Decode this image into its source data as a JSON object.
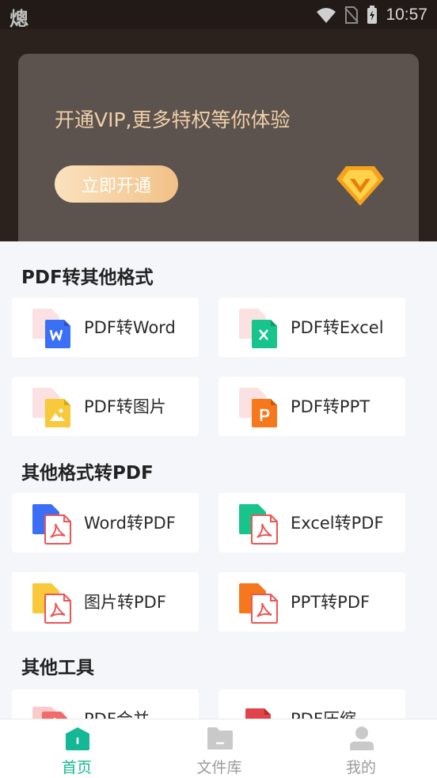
{
  "status_bar": {
    "app_icon": "熜",
    "time": "10:57",
    "icons": [
      "wifi-icon",
      "no-sim-icon",
      "battery-icon"
    ]
  },
  "vip_banner": {
    "text": "开通VIP,更多特权等你体验",
    "button_label": "立即开通",
    "badge_icon": "vip-diamond-icon"
  },
  "sections": [
    {
      "title": "PDF转其他格式",
      "items": [
        {
          "label": "PDF转Word",
          "icon": "pdf-to-word-icon"
        },
        {
          "label": "PDF转Excel",
          "icon": "pdf-to-excel-icon"
        },
        {
          "label": "PDF转图片",
          "icon": "pdf-to-image-icon"
        },
        {
          "label": "PDF转PPT",
          "icon": "pdf-to-ppt-icon"
        }
      ]
    },
    {
      "title": "其他格式转PDF",
      "items": [
        {
          "label": "Word转PDF",
          "icon": "word-to-pdf-icon"
        },
        {
          "label": "Excel转PDF",
          "icon": "excel-to-pdf-icon"
        },
        {
          "label": "图片转PDF",
          "icon": "image-to-pdf-icon"
        },
        {
          "label": "PPT转PDF",
          "icon": "ppt-to-pdf-icon"
        }
      ]
    },
    {
      "title": "其他工具",
      "items": [
        {
          "label": "PDF合并",
          "icon": "pdf-merge-icon"
        },
        {
          "label": "PDF压缩",
          "icon": "pdf-compress-icon"
        }
      ]
    }
  ],
  "bottom_nav": [
    {
      "label": "首页",
      "icon": "home-icon",
      "active": true
    },
    {
      "label": "文件库",
      "icon": "folder-icon",
      "active": false
    },
    {
      "label": "我的",
      "icon": "profile-icon",
      "active": false
    }
  ],
  "colors": {
    "accent": "#14b894",
    "vip_text": "#efcfa8",
    "word": "#3b6ff5",
    "excel": "#16c48c",
    "image": "#f8c93a",
    "ppt": "#f7781c",
    "pdf": "#ef5454"
  }
}
